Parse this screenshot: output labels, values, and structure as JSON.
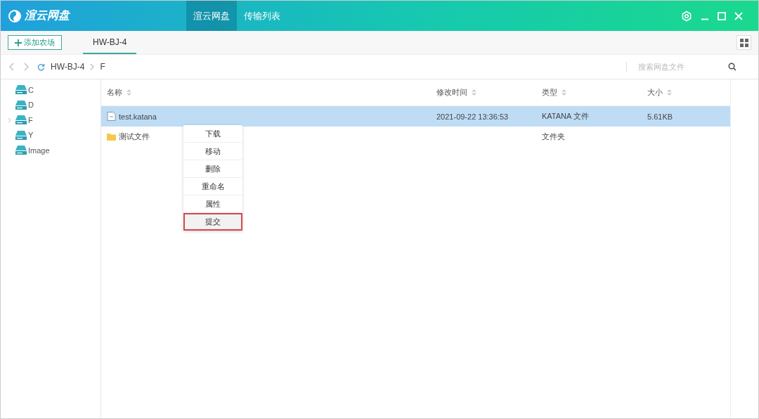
{
  "app": {
    "logo": "渲云网盘"
  },
  "nav_tabs": [
    {
      "label": "渲云网盘",
      "selected": true
    },
    {
      "label": "传输列表",
      "selected": false
    }
  ],
  "toolbar": {
    "add_button": "添加农场",
    "tabs": [
      {
        "label": "HW-BJ-4",
        "selected": true
      }
    ]
  },
  "breadcrumb": {
    "items": [
      "HW-BJ-4",
      "F"
    ]
  },
  "search": {
    "placeholder": "搜索网盘文件"
  },
  "sidebar": {
    "items": [
      {
        "label": "C",
        "expandable": false
      },
      {
        "label": "D",
        "expandable": false
      },
      {
        "label": "F",
        "expandable": true
      },
      {
        "label": "Y",
        "expandable": false
      },
      {
        "label": "Image",
        "expandable": false
      }
    ]
  },
  "table": {
    "columns": [
      "名称",
      "修改时间",
      "类型",
      "大小"
    ],
    "rows": [
      {
        "kind": "file",
        "selected": true,
        "cells": [
          "test.katana",
          "2021-09-22 13:36:53",
          "KATANA 文件",
          "5.61KB"
        ]
      },
      {
        "kind": "folder",
        "selected": false,
        "cells": [
          "测试文件",
          "",
          "文件夹",
          ""
        ]
      }
    ]
  },
  "context_menu": {
    "items": [
      {
        "label": "下载",
        "selected": false
      },
      {
        "label": "移动",
        "selected": false
      },
      {
        "label": "删除",
        "selected": false
      },
      {
        "label": "重命名",
        "selected": false
      },
      {
        "label": "属性",
        "selected": false
      },
      {
        "label": "提交",
        "selected": true
      }
    ]
  }
}
